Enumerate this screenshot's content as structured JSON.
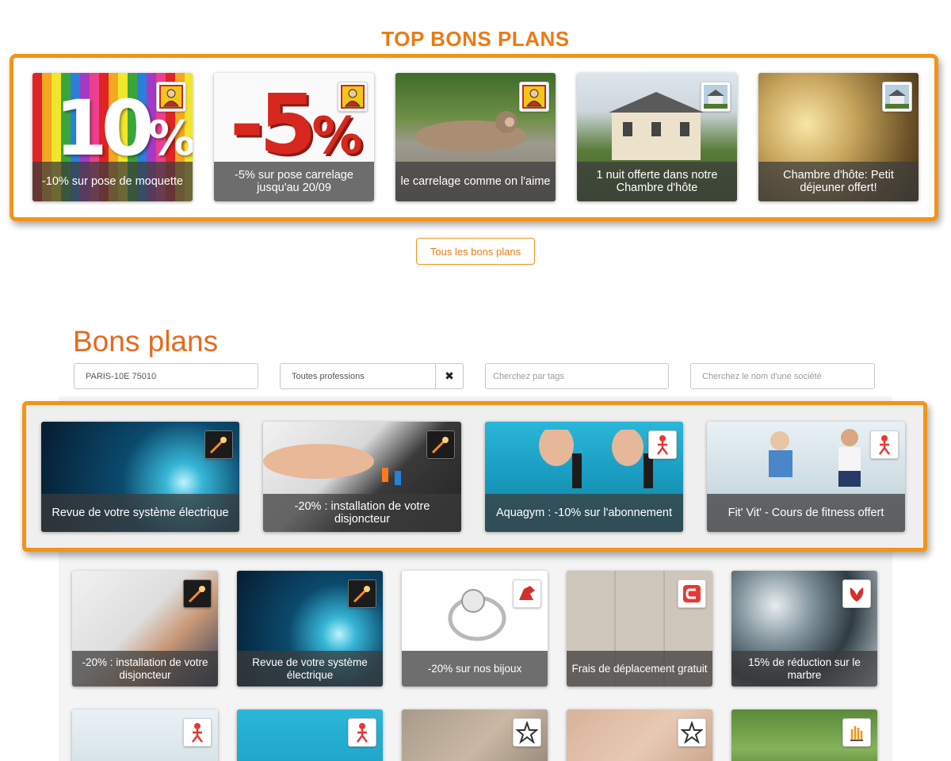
{
  "top": {
    "title": "TOP BONS PLANS",
    "cards": [
      {
        "caption": "-10% sur pose de moquette",
        "logo": "worker-mascot-icon"
      },
      {
        "caption": "-5% sur pose carrelage jusqu'au 20/09",
        "logo": "worker-mascot-icon"
      },
      {
        "caption": "le carrelage comme on l'aime",
        "logo": "worker-mascot-icon"
      },
      {
        "caption": "1 nuit offerte dans notre Chambre d'hôte",
        "logo": "house-photo-icon"
      },
      {
        "caption": "Chambre d'hôte: Petit déjeuner offert!",
        "logo": "house-photo-icon"
      }
    ],
    "all_button": "Tous les bons plans"
  },
  "bons_plans": {
    "title": "Bons plans",
    "filters": {
      "location": "PARIS-10E 75010",
      "profession": "Toutes professions",
      "clear": "✖",
      "tags_placeholder": "Cherchez par tags",
      "company_placeholder": "Cherchez le nom d'une société"
    },
    "featured": [
      {
        "caption": "Revue de votre système électrique",
        "logo": "spark-icon"
      },
      {
        "caption": "-20% : installation de votre disjoncteur",
        "logo": "spark-icon"
      },
      {
        "caption": "Aquagym : -10% sur l'abonnement",
        "logo": "fitness-icon"
      },
      {
        "caption": "Fit' Vit' - Cours de fitness offert",
        "logo": "fitness-icon"
      }
    ],
    "grid": [
      {
        "caption": "-20% : installation de votre disjoncteur",
        "logo": "spark-icon"
      },
      {
        "caption": "Revue de votre système électrique",
        "logo": "spark-icon"
      },
      {
        "caption": "-20% sur nos bijoux",
        "logo": "red-horse-icon"
      },
      {
        "caption": "Frais de déplacement gratuit",
        "logo": "red-c-icon"
      },
      {
        "caption": "15% de réduction sur le marbre",
        "logo": "red-flower-icon"
      },
      {
        "caption": "",
        "logo": "fitness-icon"
      },
      {
        "caption": "",
        "logo": "fitness-icon"
      },
      {
        "caption": "",
        "logo": "star-flower-icon"
      },
      {
        "caption": "",
        "logo": "star-flower-icon"
      },
      {
        "caption": "",
        "logo": "hand-icon"
      }
    ]
  },
  "colors": {
    "accent": "#f39419",
    "title": "#ec7a12",
    "bons_plans_title": "#e8691b"
  }
}
